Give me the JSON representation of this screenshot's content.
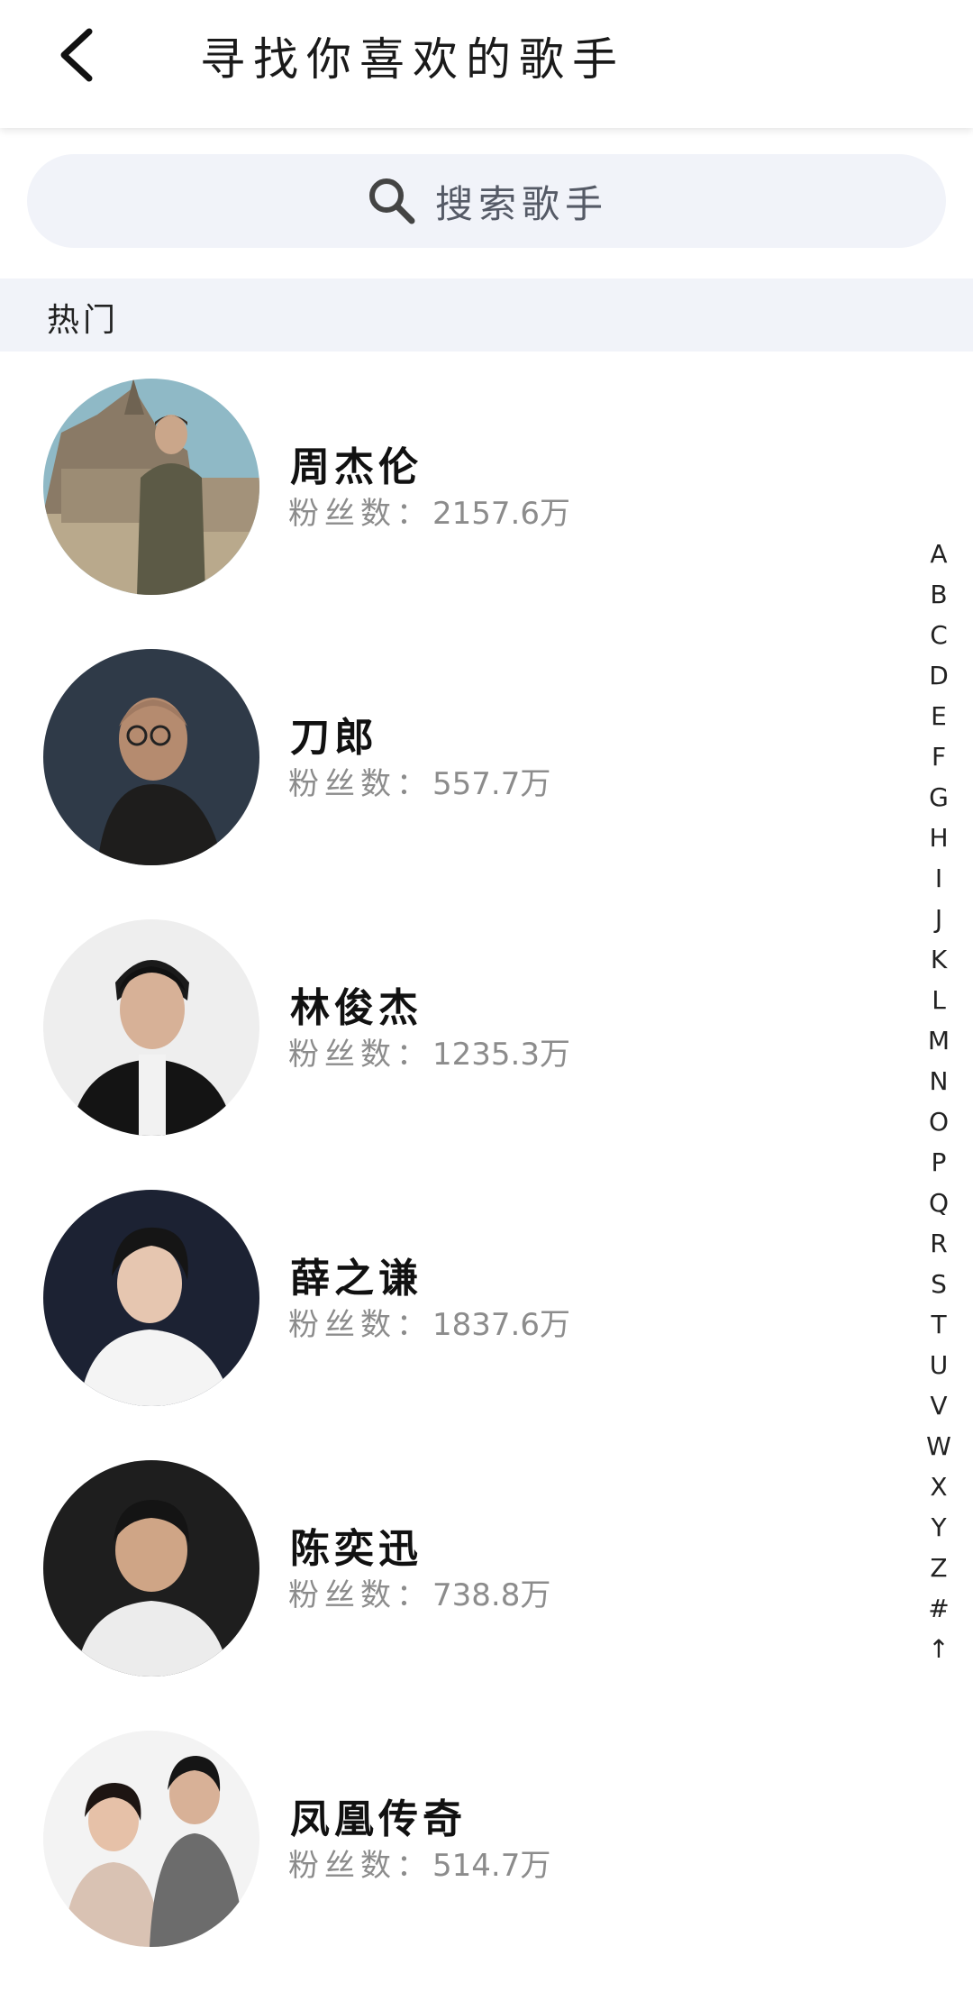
{
  "header": {
    "back_icon": "chevron-left-icon",
    "title": "寻找你喜欢的歌手"
  },
  "search": {
    "icon": "search-icon",
    "placeholder": "搜索歌手"
  },
  "section": {
    "label": "热门"
  },
  "fans_label": "粉丝数：",
  "singers": [
    {
      "name": "周杰伦",
      "fans": "2157.6万"
    },
    {
      "name": "刀郎",
      "fans": "557.7万"
    },
    {
      "name": "林俊杰",
      "fans": "1235.3万"
    },
    {
      "name": "薛之谦",
      "fans": "1837.6万"
    },
    {
      "name": "陈奕迅",
      "fans": "738.8万"
    },
    {
      "name": "凤凰传奇",
      "fans": "514.7万"
    }
  ],
  "index_bar": [
    "A",
    "B",
    "C",
    "D",
    "E",
    "F",
    "G",
    "H",
    "I",
    "J",
    "K",
    "L",
    "M",
    "N",
    "O",
    "P",
    "Q",
    "R",
    "S",
    "T",
    "U",
    "V",
    "W",
    "X",
    "Y",
    "Z",
    "#",
    "↑"
  ]
}
